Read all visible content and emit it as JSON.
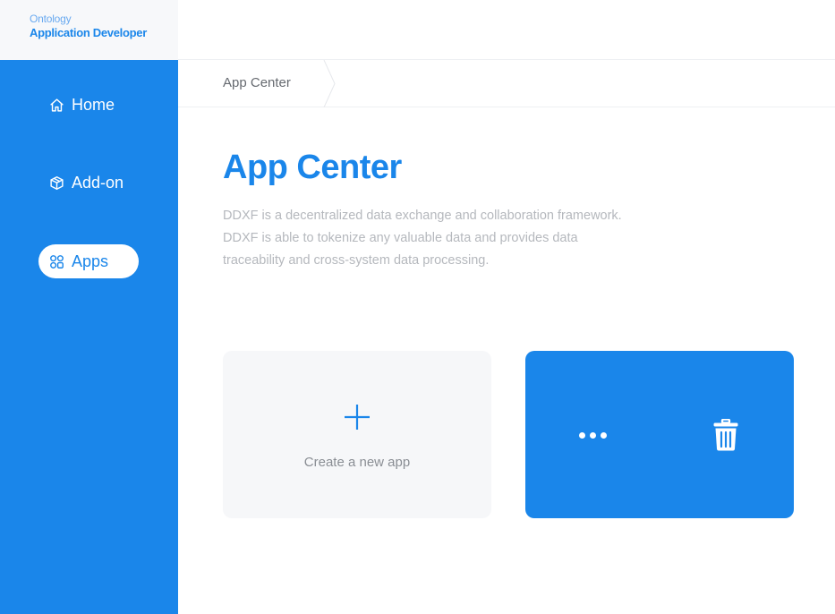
{
  "brand": {
    "line1": "Ontology",
    "line2": "Application Developer"
  },
  "sidebar": {
    "items": [
      {
        "label": "Home",
        "icon": "home-icon",
        "active": false
      },
      {
        "label": "Add-on",
        "icon": "cube-icon",
        "active": false
      },
      {
        "label": "Apps",
        "icon": "apps-grid-icon",
        "active": true
      }
    ]
  },
  "breadcrumb": {
    "current": "App Center"
  },
  "main": {
    "title": "App Center",
    "description": [
      "DDXF is a decentralized data exchange and collaboration framework.",
      "DDXF is able to tokenize any valuable data and provides data",
      "traceability and cross-system data processing."
    ],
    "new_app_label": "Create a new app"
  },
  "colors": {
    "accent": "#1a86ea",
    "card_bg": "#f6f7f9",
    "desc_text": "#b5b8bd"
  }
}
